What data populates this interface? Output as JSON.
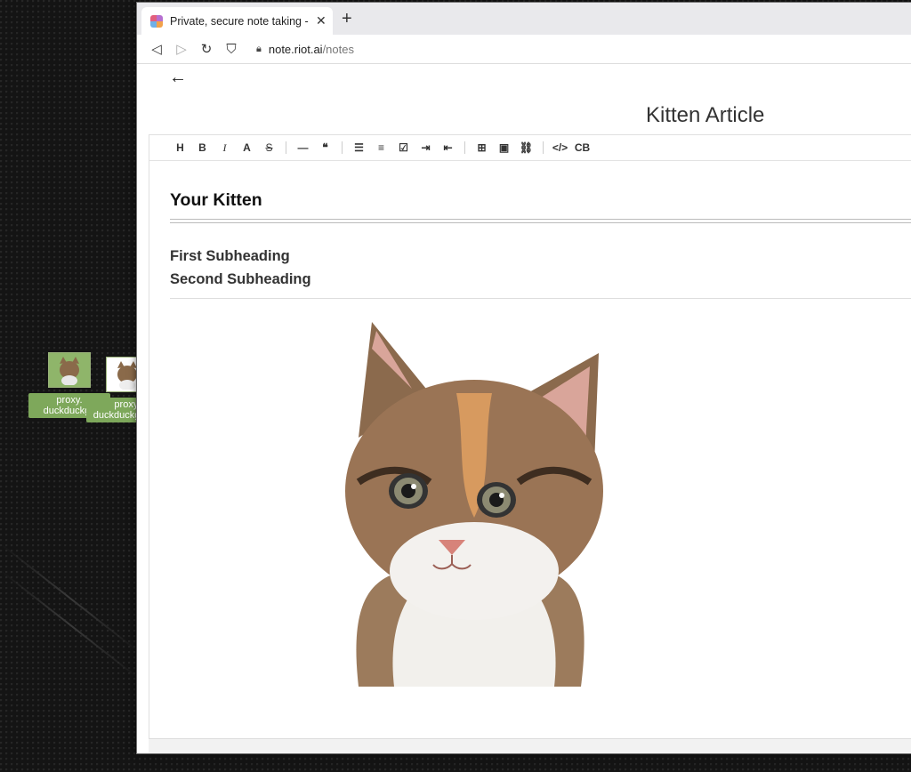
{
  "desktop": {
    "icons": [
      {
        "label_line1": "proxy.",
        "label_line2": "duckduckgo"
      },
      {
        "label_line1": "proxy.",
        "label_line2": "duckduckgo.jpg"
      }
    ]
  },
  "browser": {
    "tab": {
      "title": "Private, secure note taking - No",
      "close": "✕"
    },
    "new_tab": "+",
    "nav": {
      "back": "◁",
      "forward": "▷",
      "reload": "↻",
      "bookmark": "⛉"
    },
    "url": {
      "host": "note.riot.ai",
      "path": "/notes"
    }
  },
  "note": {
    "back": "←",
    "title": "Kitten Article",
    "toolbar": [
      {
        "label": "H",
        "icon": "heading-icon"
      },
      {
        "label": "B",
        "icon": "bold-icon"
      },
      {
        "label": "I",
        "icon": "italic-icon"
      },
      {
        "label": "A",
        "icon": "text-color-icon"
      },
      {
        "label": "S",
        "icon": "strikethrough-icon"
      },
      {
        "label": "—",
        "icon": "horizontal-rule-icon"
      },
      {
        "label": "❝",
        "icon": "quote-icon"
      },
      {
        "label": "☰",
        "icon": "bullet-list-icon"
      },
      {
        "label": "≡",
        "icon": "numbered-list-icon"
      },
      {
        "label": "☑",
        "icon": "task-list-icon"
      },
      {
        "label": "⇥",
        "icon": "indent-icon"
      },
      {
        "label": "⇤",
        "icon": "outdent-icon"
      },
      {
        "label": "⊞",
        "icon": "table-icon"
      },
      {
        "label": "▣",
        "icon": "image-icon"
      },
      {
        "label": "⛓",
        "icon": "link-icon"
      },
      {
        "label": "</>",
        "icon": "code-icon"
      },
      {
        "label": "CB",
        "icon": "codeblock-icon"
      }
    ],
    "heading1": "Your Kitten",
    "heading2_a": "First Subheading",
    "heading2_b": "Second Subheading"
  },
  "colors": {
    "desktop_bg": "#141414",
    "icon_label_bg": "#7ea85b"
  }
}
